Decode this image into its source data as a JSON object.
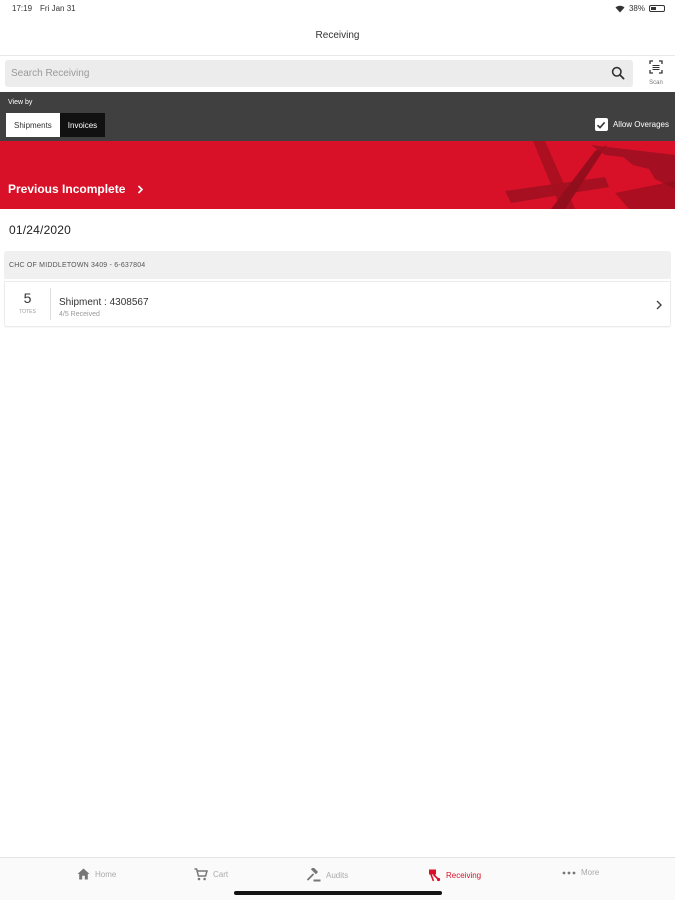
{
  "status": {
    "time": "17:19",
    "date": "Fri Jan 31",
    "battery": "38%",
    "battery_level": 0.38
  },
  "header": {
    "title": "Receiving"
  },
  "search": {
    "placeholder": "Search Receiving",
    "scan_label": "Scan"
  },
  "filter": {
    "view_by_label": "View by",
    "options": [
      "Shipments",
      "Invoices"
    ],
    "selected": "Shipments",
    "allow_overages_label": "Allow Overages",
    "allow_overages_checked": true
  },
  "banner": {
    "text": "Previous Incomplete"
  },
  "date_heading": "01/24/2020",
  "group": {
    "header": "CHC OF MIDDLETOWN 3409 - 6-637804",
    "shipments": [
      {
        "tote_count": "5",
        "tote_unit": "TOTES",
        "title": "Shipment : 4308567",
        "subtitle": "4/5 Received"
      }
    ]
  },
  "tabs": [
    {
      "label": "Home",
      "icon": "home-icon"
    },
    {
      "label": "Cart",
      "icon": "cart-icon"
    },
    {
      "label": "Audits",
      "icon": "gavel-icon"
    },
    {
      "label": "Receiving",
      "icon": "receiving-icon",
      "active": true
    },
    {
      "label": "More",
      "icon": "more-icon"
    }
  ],
  "colors": {
    "brand_red": "#d81128",
    "filter_bar": "#404040",
    "inactive_segment": "#111111"
  }
}
